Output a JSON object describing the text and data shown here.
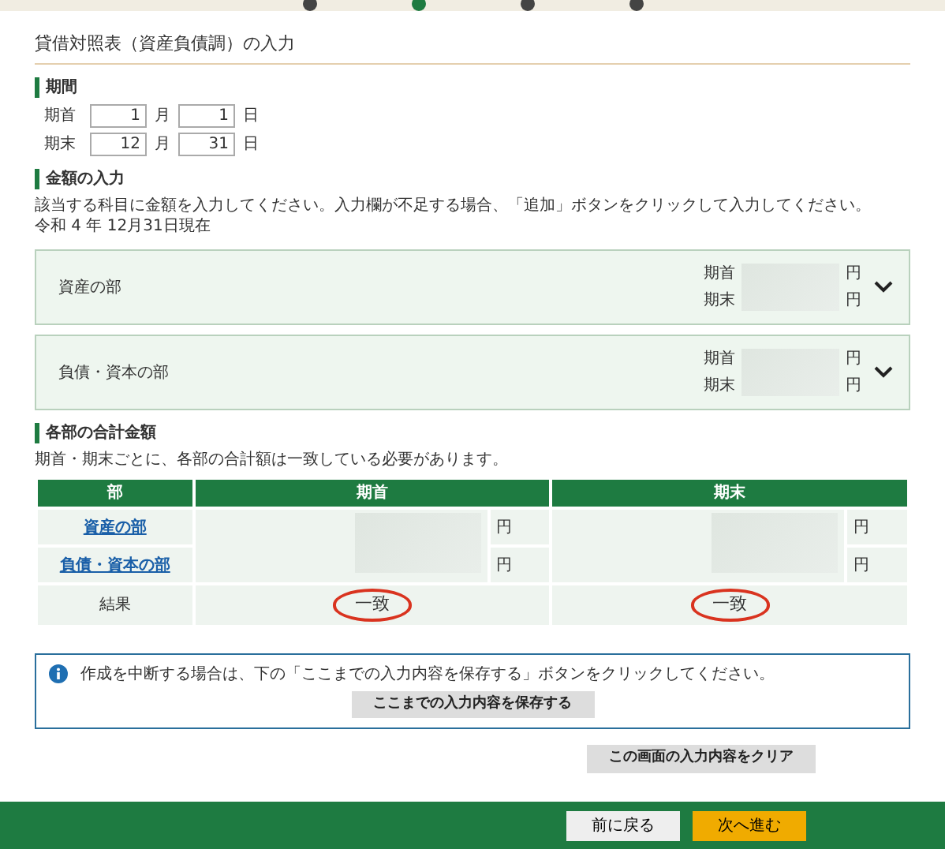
{
  "steps": [
    {
      "current": false
    },
    {
      "current": true
    },
    {
      "current": false
    },
    {
      "current": false
    }
  ],
  "page_title": "貸借対照表（資産負債調）の入力",
  "period": {
    "heading": "期間",
    "rows": [
      {
        "label": "期首",
        "month": "1",
        "month_unit": "月",
        "day": "1",
        "day_unit": "日"
      },
      {
        "label": "期末",
        "month": "12",
        "month_unit": "月",
        "day": "31",
        "day_unit": "日"
      }
    ]
  },
  "amounts": {
    "heading": "金額の入力",
    "instruction": "該当する科目に金額を入力してください。入力欄が不足する場合、「追加」ボタンをクリックして入力してください。",
    "as_of": "令和 4 年 12月31日現在",
    "sections": [
      {
        "name": "資産の部",
        "expanded": false,
        "rows": [
          {
            "label": "期首",
            "unit": "円"
          },
          {
            "label": "期末",
            "unit": "円"
          }
        ]
      },
      {
        "name": "負債・資本の部",
        "expanded": false,
        "rows": [
          {
            "label": "期首",
            "unit": "円"
          },
          {
            "label": "期末",
            "unit": "円"
          }
        ]
      }
    ]
  },
  "totals": {
    "heading": "各部の合計金額",
    "note": "期首・期末ごとに、各部の合計額は一致している必要があります。",
    "columns": [
      "部",
      "期首",
      "期末"
    ],
    "rows": [
      {
        "label": "資産の部",
        "link": true,
        "unit_start": "円",
        "unit_end": "円"
      },
      {
        "label": "負債・資本の部",
        "link": true,
        "unit_start": "円",
        "unit_end": "円"
      }
    ],
    "result": {
      "label": "結果",
      "start": "一致",
      "end": "一致",
      "circled": true
    }
  },
  "save_box": {
    "message": "作成を中断する場合は、下の「ここまでの入力内容を保存する」ボタンをクリックしてください。",
    "button": "ここまでの入力内容を保存する"
  },
  "clear_button": "この画面の入力内容をクリア",
  "footer": {
    "back": "前に戻る",
    "next": "次へ進む"
  }
}
